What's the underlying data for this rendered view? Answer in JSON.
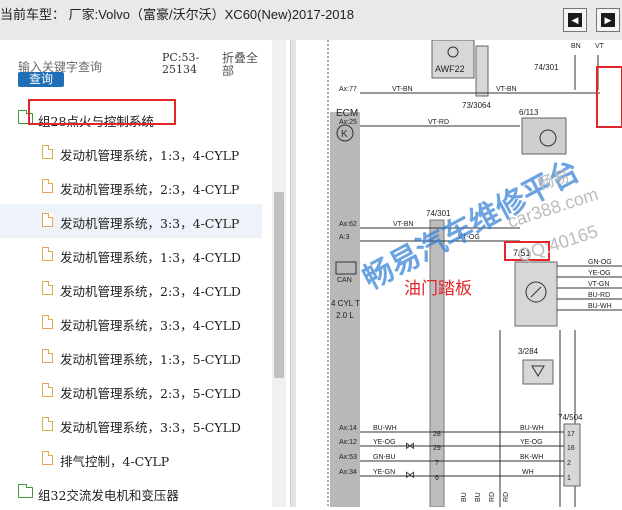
{
  "header": {
    "title": "当前车型： 厂家:Volvo（富豪/沃尔沃）XC60(New)2017-2018"
  },
  "search": {
    "label": "输入关键字查询",
    "button": "查询",
    "pc_line1": "PC:53-",
    "pc_line2": "25134",
    "fold_line1": "折叠全",
    "fold_line2": "部"
  },
  "tree": {
    "group1": "组28点火与控制系统",
    "items": [
      "发动机管理系统，1:3，4-CYLP",
      "发动机管理系统，2:3，4-CYLP",
      "发动机管理系统，3:3，4-CYLP",
      "发动机管理系统，1:3，4-CYLD",
      "发动机管理系统，2:3，4-CYLD",
      "发动机管理系统，3:3，4-CYLD",
      "发动机管理系统，1:3，5-CYLD",
      "发动机管理系统，2:3，5-CYLD",
      "发动机管理系统，3:3，5-CYLD",
      "排气控制，4-CYLP"
    ],
    "group2": "组32交流发电机和变压器"
  },
  "diagram": {
    "awf22": "AWF22",
    "ref_7430": "74/301",
    "ref_73064": "73/3064",
    "ref_6113": "6/113",
    "ecm": "ECM",
    "ref_74301b": "74/301",
    "ref_751": "7/51",
    "can": "CAN",
    "cyl1": "4 CYL T",
    "cyl2": "2.0 L",
    "ref_3284": "3/284",
    "ref_74504": "74/504",
    "callout": "油门踏板",
    "wm1": "畅易汽车维修平台",
    "wm2": "car388.com",
    "wm3": "QQ:40165",
    "wm4": "畅易",
    "left_wires": [
      {
        "pin": "Ax:77",
        "color": "VT-BN"
      },
      {
        "pin": "Ax:25",
        "color": "VT-RD"
      },
      {
        "pin": "Ax:62",
        "color": "VT-BN"
      },
      {
        "pin": "A:3",
        "color": "VT-OG"
      },
      {
        "pin": "Ax:14",
        "color": "BU-WH"
      },
      {
        "pin": "Ax:12",
        "color": "YE-OG"
      },
      {
        "pin": "Ax:53",
        "color": "GN-BU"
      },
      {
        "pin": "Ax:34",
        "color": "YE-GN"
      }
    ],
    "pedal_wires": [
      "GN-OG",
      "YE-OG",
      "VT-GN",
      "BU-RD",
      "BU-WH"
    ],
    "bottom_wires": [
      {
        "color": "BU-WH",
        "pin": "17"
      },
      {
        "color": "YE-OG",
        "pin": "16"
      },
      {
        "color": "BK-WH",
        "pin": "2"
      },
      {
        "color": "WH",
        "pin": "1"
      }
    ],
    "left_pins": [
      "28",
      "29",
      "7",
      "6"
    ],
    "bottom_labels": [
      "BU",
      "BU",
      "RD",
      "RD"
    ],
    "top_labels": [
      "VT",
      "BN",
      "BN"
    ],
    "vt_gn": "VT-GN",
    "vt_bn": "VT-BN",
    "vt_rd": "VT-RD"
  }
}
